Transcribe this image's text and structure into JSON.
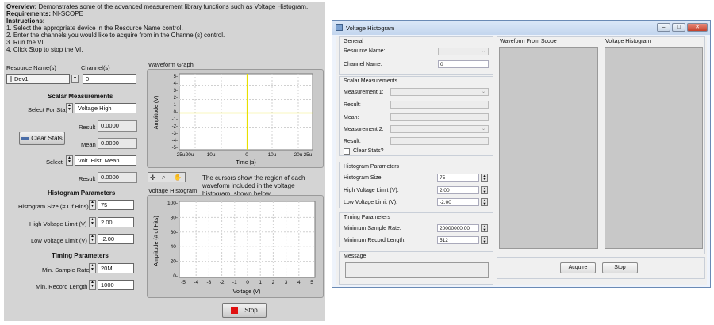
{
  "lv": {
    "overview_label": "Overview:",
    "overview_text": " Demonstrates some of the advanced measurement library functions such as Voltage Histogram.",
    "requirements_label": "Requirements:",
    "requirements_text": " NI-SCOPE",
    "instructions_label": "Instructions:",
    "steps": [
      "1.  Select the appropriate device in the Resource Name control.",
      "2.  Enter the channels you would like to acquire from in the Channel(s) control.",
      "3.  Run the VI.",
      "4.  Click Stop to stop the VI."
    ],
    "resource_label": "Resource Name(s)",
    "resource_value": "Dev1",
    "channel_label": "Channel(s)",
    "channel_value": "0",
    "scalar_title": "Scalar Measurements",
    "select_for_stats_label": "Select For Stats",
    "select_for_stats_value": "Voltage High",
    "result_label": "Result",
    "result_value": "0.0000",
    "clear_stats": "Clear Stats",
    "mean_label": "Mean",
    "mean_value": "0.0000",
    "select_label": "Select",
    "select_value": "Volt. Hist. Mean",
    "result2_label": "Result",
    "result2_value": "0.0000",
    "hist_title": "Histogram Parameters",
    "hist_size_label": "Histogram Size (# Of Bins)",
    "hist_size_value": "75",
    "high_limit_label": "High Voltage Limit (V)",
    "high_limit_value": "2.00",
    "low_limit_label": "Low Voltage Limit (V)",
    "low_limit_value": "-2.00",
    "timing_title": "Timing Parameters",
    "min_rate_label": "Min. Sample Rate",
    "min_rate_value": "20M",
    "min_record_label": "Min. Record Length",
    "min_record_value": "1000",
    "stop": "Stop",
    "waveform_graph_label": "Waveform Graph",
    "wf_ylabel": "Amplitude (V)",
    "wf_xlabel": "Time (s)",
    "wf_yticks": [
      "5-",
      "4-",
      "3-",
      "2-",
      "1-",
      "0-",
      "-1-",
      "-2-",
      "-3-",
      "-4-",
      "-5-"
    ],
    "wf_yticks_shown": [
      "5",
      "4",
      "3",
      "2",
      "1",
      "0",
      "-1",
      "-2",
      "-3",
      "-4",
      "-5"
    ],
    "wf_xticks": [
      "-25u",
      "-20u",
      "-10u",
      "0",
      "10u",
      "20u",
      "25u"
    ],
    "cursor_note": "The cursors show the region of each waveform included in the voltage histogram, shown below.",
    "vh_label": "Voltage Histogram",
    "vh_ylabel": "Amplitude (# of Hits)",
    "vh_xlabel": "Voltage (V)",
    "vh_yticks": [
      "100",
      "80",
      "60",
      "40",
      "20",
      "0"
    ],
    "vh_xticks": [
      "-5",
      "-4",
      "-3",
      "-2",
      "-1",
      "0",
      "1",
      "2",
      "3",
      "4",
      "5"
    ]
  },
  "dlg": {
    "title": "Voltage Histogram",
    "general": "General",
    "resource_name": "Resource Name:",
    "channel_name": "Channel Name:",
    "channel_value": "0",
    "scalar": "Scalar Measurements",
    "measurement1": "Measurement 1:",
    "result": "Result:",
    "mean": "Mean:",
    "measurement2": "Measurement 2:",
    "result2": "Result:",
    "clear_stats": "Clear Stats?",
    "hist_params": "Histogram Parameters",
    "hist_size": "Histogram Size:",
    "hist_size_value": "75",
    "high_limit": "High Voltage Limit (V):",
    "high_limit_value": "2.00",
    "low_limit": "Low Voltage Limit (V):",
    "low_limit_value": "-2.00",
    "timing": "Timing Parameters",
    "min_rate": "Minimum Sample Rate:",
    "min_rate_value": "20000000.00",
    "min_record": "Minimum Record Length:",
    "min_record_value": "512",
    "message": "Message",
    "waveform_label": "Waveform From Scope",
    "histogram_label": "Voltage Histogram",
    "acquire": "Acquire",
    "stop": "Stop"
  }
}
